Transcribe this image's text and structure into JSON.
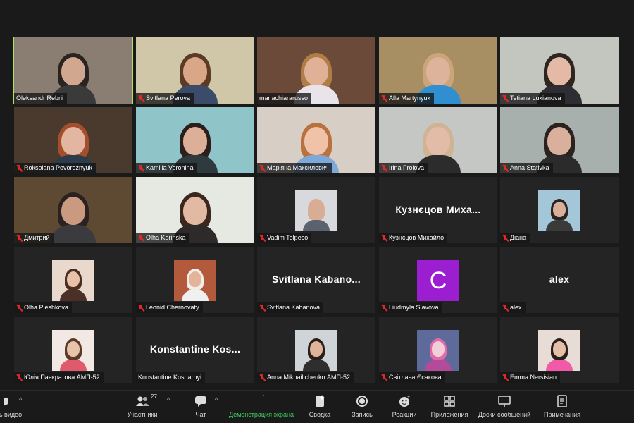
{
  "participants": [
    {
      "name": "Oleksandr Rebrii",
      "muted": false,
      "active": true,
      "kind": "video",
      "bg": "#8a7e73",
      "shirt": "#3a3a3a",
      "skin": "#d1a88f",
      "hair": "#2b2320"
    },
    {
      "name": "Svitlana Perova",
      "muted": true,
      "kind": "video",
      "bg": "#cfc7a8",
      "shirt": "#3b4b6a",
      "skin": "#d9a788",
      "hair": "#5b3b25"
    },
    {
      "name": "mariachiararusso",
      "muted": false,
      "kind": "video",
      "bg": "#6b4a3a",
      "shirt": "#e8e4ea",
      "skin": "#e1b197",
      "hair": "#b07d47"
    },
    {
      "name": "Alla Martynyuk",
      "muted": true,
      "kind": "video",
      "bg": "#a88f63",
      "shirt": "#2f8fd0",
      "skin": "#ddb39c",
      "hair": "#caa57a"
    },
    {
      "name": "Tetiana Lukianova",
      "muted": true,
      "kind": "video",
      "bg": "#c3c6bf",
      "shirt": "#2e2d33",
      "skin": "#e4b9a6",
      "hair": "#2e2420"
    },
    {
      "name": "Roksolana Povoroznyuk",
      "muted": true,
      "kind": "video",
      "bg": "#4a3a2e",
      "shirt": "#2c3c4c",
      "skin": "#e2b6a0",
      "hair": "#a44f2b"
    },
    {
      "name": "Kamilla Voronina",
      "muted": true,
      "kind": "video",
      "bg": "#8fc5c9",
      "shirt": "#2f3a3f",
      "skin": "#dcaf98",
      "hair": "#2a1f1c"
    },
    {
      "name": "Мар'яна Максилевич",
      "muted": true,
      "kind": "video",
      "bg": "#d7cfc6",
      "shirt": "#7da9d8",
      "skin": "#f0c2a8",
      "hair": "#b9713e"
    },
    {
      "name": "Irina Frolova",
      "muted": true,
      "kind": "video",
      "bg": "#c4c7c3",
      "shirt": "#2c2c2c",
      "skin": "#e2bca8",
      "hair": "#cfb493"
    },
    {
      "name": "Anna Stativka",
      "muted": true,
      "kind": "video",
      "bg": "#a8b0ad",
      "shirt": "#2b2b2b",
      "skin": "#d9b09b",
      "hair": "#2b2220"
    },
    {
      "name": "Дмитрий",
      "muted": true,
      "kind": "video",
      "bg": "#5e4a33",
      "shirt": "#3b3b3f",
      "skin": "#c99a80",
      "hair": "#2a2220"
    },
    {
      "name": "Olha Korinska",
      "muted": true,
      "kind": "video",
      "bg": "#e6e8e2",
      "shirt": "#2e2a2a",
      "skin": "#e2b9a3",
      "hair": "#3a281e"
    },
    {
      "name": "Vadim Tolpeco",
      "muted": true,
      "kind": "photo",
      "bg": "#d7d9dc",
      "shirt": "#5a6270",
      "skin": "#d8ad93",
      "hair": "#d8ad93"
    },
    {
      "name": "Кузнєцов Михайло",
      "muted": true,
      "kind": "text",
      "big": "Кузнєцов Миха..."
    },
    {
      "name": "Діана",
      "muted": true,
      "kind": "photo",
      "bg": "#a3c6d8",
      "shirt": "#3a3a3a",
      "skin": "#d8b09a",
      "hair": "#2c2320"
    },
    {
      "name": "Olha Pieshkova",
      "muted": true,
      "kind": "photo",
      "bg": "#e8d9cc",
      "shirt": "#4a3026",
      "skin": "#e8c1a9",
      "hair": "#4a2e1f"
    },
    {
      "name": "Leonid Chernovaty",
      "muted": true,
      "kind": "photo",
      "bg": "#b45a3c",
      "shirt": "#f0f0f0",
      "skin": "#e3b39a",
      "hair": "#f0eeea"
    },
    {
      "name": "Svitlana Kabanova",
      "muted": true,
      "kind": "text",
      "big": "Svitlana  Kabano..."
    },
    {
      "name": "Liudmyla Slavova",
      "muted": true,
      "kind": "letter",
      "letter": "C"
    },
    {
      "name": "alex",
      "muted": true,
      "kind": "text",
      "big": "alex"
    },
    {
      "name": "Юлія Панкратова АМП-52",
      "muted": true,
      "kind": "photo",
      "bg": "#f2e9e4",
      "shirt": "#e05a6e",
      "skin": "#e8c3ab",
      "hair": "#5a3a26"
    },
    {
      "name": "Konstantine Kosharnyi",
      "muted": false,
      "kind": "text",
      "big": "Konstantine  Kos..."
    },
    {
      "name": "Anna Mikhailichenko АМП-52",
      "muted": true,
      "kind": "photo",
      "bg": "#cfd4d8",
      "shirt": "#2e2e2e",
      "skin": "#e0b39b",
      "hair": "#2a1e1a"
    },
    {
      "name": "Світлана Єсакова",
      "muted": true,
      "kind": "photo",
      "bg": "#5d6a9a",
      "shirt": "#b44a9a",
      "skin": "#f2cfd8",
      "hair": "#e06aa8"
    },
    {
      "name": "Emma Nersisian",
      "muted": true,
      "kind": "photo",
      "bg": "#e7dcd6",
      "shirt": "#f05aa6",
      "skin": "#e6bfa8",
      "hair": "#2a1e1a"
    }
  ],
  "toolbar": {
    "video_label": "ь видео",
    "participants_label": "Участники",
    "participants_count": "27",
    "chat_label": "Чат",
    "share_label": "Демонстрация экрана",
    "reactions_summary_label": "Сводка",
    "record_label": "Запись",
    "reactions_label": "Реакции",
    "apps_label": "Приложения",
    "whiteboard_label": "Доски сообщений",
    "notes_label": "Примечания"
  },
  "colors": {
    "active_speaker": "#b6e25e",
    "share_green": "#2bbf4b",
    "muted_red": "#e02828",
    "avatar_purple": "#9b1fd1"
  }
}
